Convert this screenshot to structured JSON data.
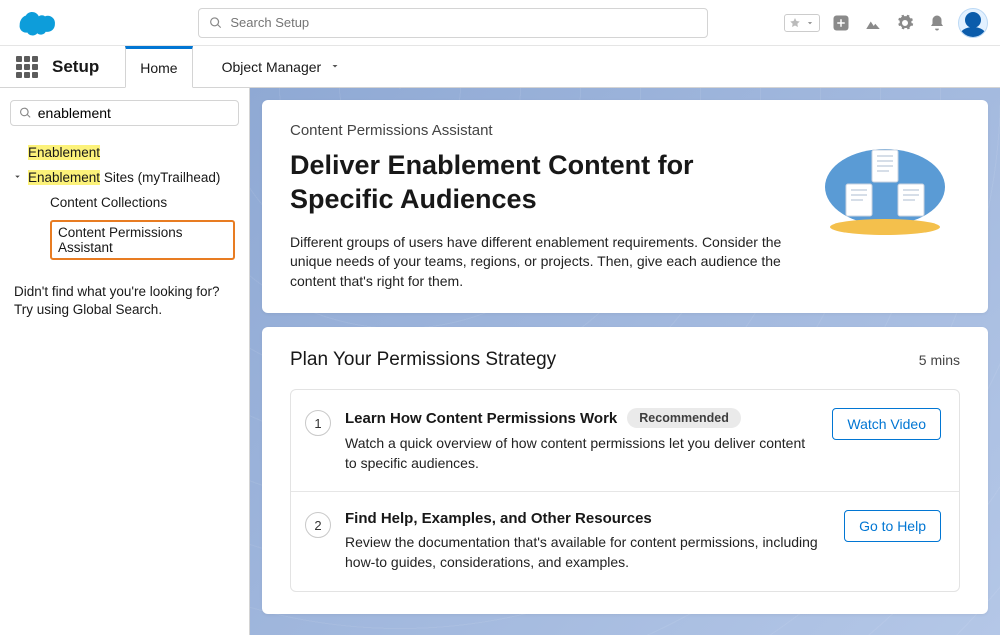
{
  "header": {
    "search_placeholder": "Search Setup"
  },
  "tabbar": {
    "title": "Setup",
    "tabs": [
      {
        "label": "Home",
        "active": true
      },
      {
        "label": "Object Manager",
        "active": false
      }
    ]
  },
  "sidebar": {
    "filter_value": "enablement",
    "tree": {
      "root": {
        "label_hl": "Enablement"
      },
      "section": {
        "label_hl": "Enablement",
        "label_rest": " Sites (myTrailhead)"
      },
      "children": [
        {
          "label": "Content Collections",
          "selected": false
        },
        {
          "label": "Content Permissions Assistant",
          "selected": true
        }
      ]
    },
    "help_text": "Didn't find what you're looking for? Try using Global Search."
  },
  "hero": {
    "eyebrow": "Content Permissions Assistant",
    "title": "Deliver Enablement Content for Specific Audiences",
    "body": "Different groups of users have different enablement requirements. Consider the unique needs of your teams, regions, or projects. Then, give each audience the content that's right for them."
  },
  "section": {
    "title": "Plan Your Permissions Strategy",
    "mins": "5 mins",
    "steps": [
      {
        "num": "1",
        "title": "Learn How Content Permissions Work",
        "badge": "Recommended",
        "desc": "Watch a quick overview of how content permissions let you deliver content to specific audiences.",
        "action": "Watch Video"
      },
      {
        "num": "2",
        "title": "Find Help, Examples, and Other Resources",
        "badge": "",
        "desc": "Review the documentation that's available for content permissions, including how-to guides, considerations, and examples.",
        "action": "Go to Help"
      }
    ]
  }
}
